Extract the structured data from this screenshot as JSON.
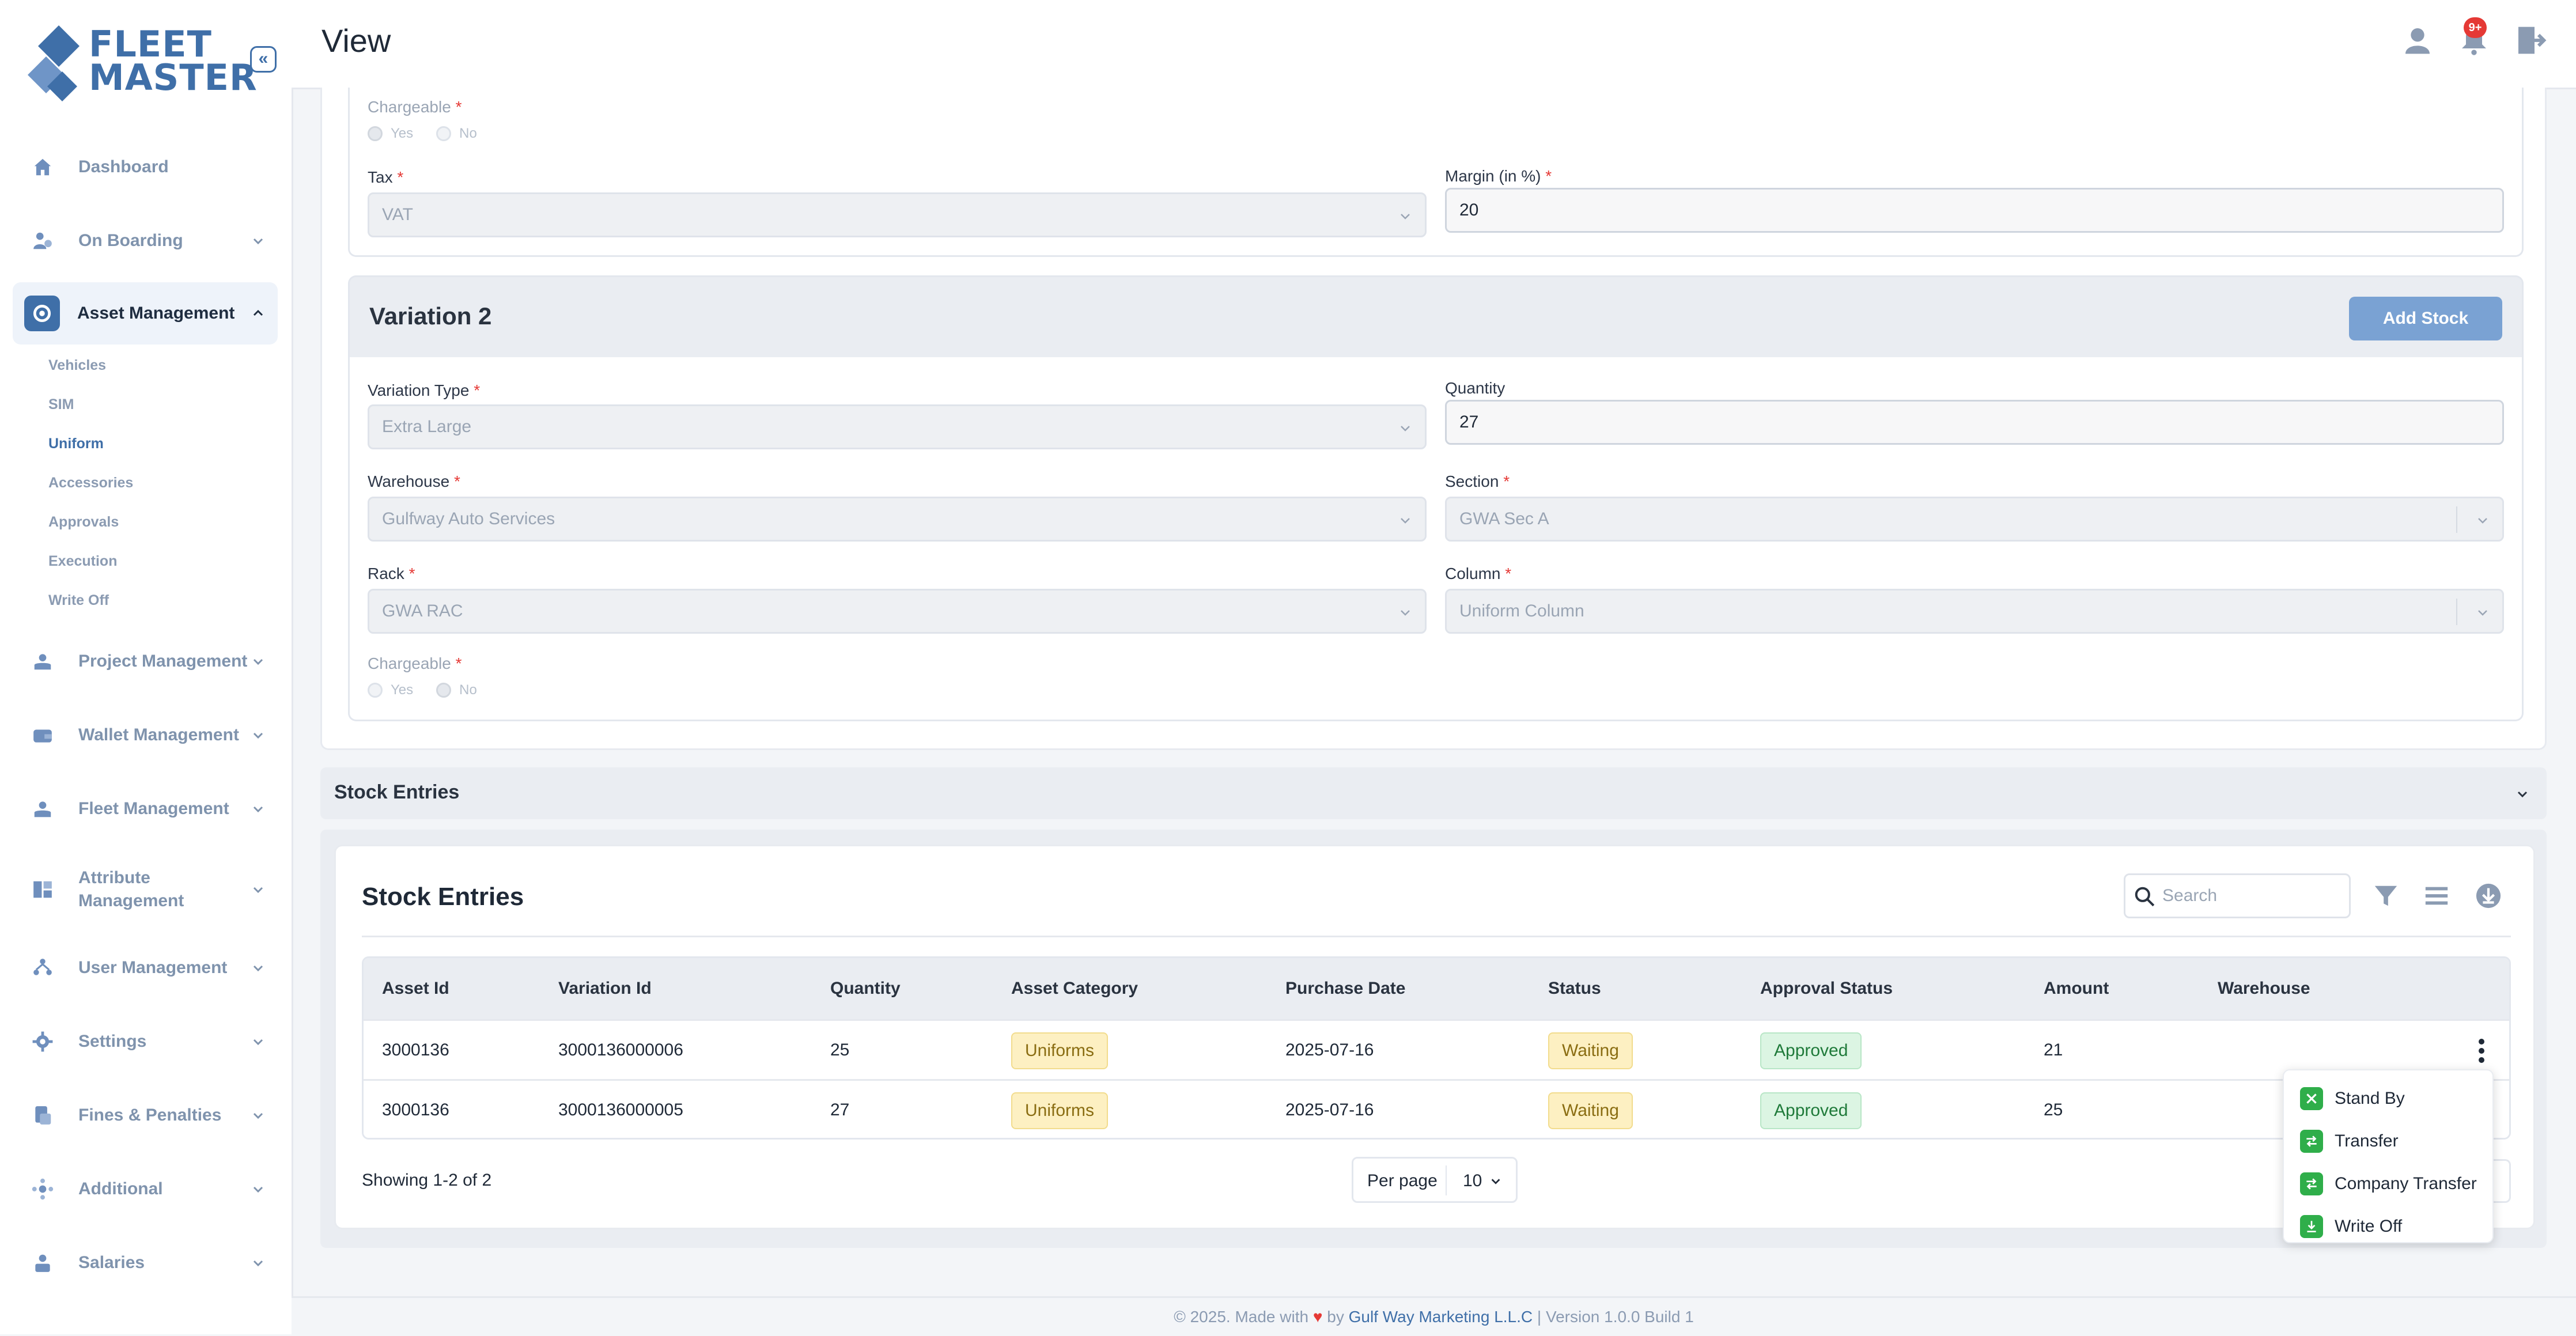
{
  "app": {
    "logo_line1": "FLEET",
    "logo_line2": "MASTER",
    "brand_color": "#3f6fa8",
    "collapse_icon": "double-chevron-left-icon"
  },
  "header": {
    "title": "View",
    "notification_badge": "9+",
    "icons": [
      "user-icon",
      "bell-icon",
      "logout-icon"
    ]
  },
  "sidebar": {
    "items": [
      {
        "label": "Dashboard",
        "icon": "home-icon"
      },
      {
        "label": "On Boarding",
        "icon": "onboarding-icon"
      },
      {
        "label": "Asset Management",
        "icon": "asset-icon"
      },
      {
        "label": "Project Management",
        "icon": "project-icon"
      },
      {
        "label": "Wallet Management",
        "icon": "wallet-icon"
      },
      {
        "label": "Fleet Management",
        "icon": "fleet-icon"
      },
      {
        "label": "Attribute Management",
        "icon": "attribute-icon"
      },
      {
        "label": "User Management",
        "icon": "users-icon"
      },
      {
        "label": "Settings",
        "icon": "gear-icon"
      },
      {
        "label": "Fines & Penalties",
        "icon": "fines-icon"
      },
      {
        "label": "Additional",
        "icon": "additional-icon"
      },
      {
        "label": "Salaries",
        "icon": "salaries-icon"
      }
    ],
    "asset_sub_items": [
      "Vehicles",
      "SIM",
      "Uniform",
      "Accessories",
      "Approvals",
      "Execution",
      "Write Off"
    ],
    "current_sub_item": "Uniform"
  },
  "variation1": {
    "chargeable_label": "Chargeable",
    "yes_label": "Yes",
    "no_label": "No",
    "tax_label": "Tax",
    "tax_value": "VAT",
    "margin_label": "Margin (in %)",
    "margin_value": "20"
  },
  "variation2": {
    "title": "Variation 2",
    "add_stock_label": "Add Stock",
    "variation_type_label": "Variation Type",
    "variation_type_value": "Extra Large",
    "quantity_label": "Quantity",
    "quantity_value": "27",
    "warehouse_label": "Warehouse",
    "warehouse_value": "Gulfway Auto Services",
    "section_label": "Section",
    "section_value": "GWA Sec A",
    "rack_label": "Rack",
    "rack_value": "GWA RAC",
    "column_label": "Column",
    "column_value": "Uniform Column",
    "chargeable_label": "Chargeable",
    "yes_label": "Yes",
    "no_label": "No"
  },
  "stock_entries_section": {
    "collapsible_title": "Stock Entries",
    "card_title": "Stock Entries",
    "search_placeholder": "Search",
    "columns": [
      "Asset Id",
      "Variation Id",
      "Quantity",
      "Asset Category",
      "Purchase Date",
      "Status",
      "Approval Status",
      "Amount",
      "Warehouse"
    ],
    "rows": [
      {
        "asset_id": "3000136",
        "variation_id": "3000136000006",
        "quantity": "25",
        "category": "Uniforms",
        "purchase_date": "2025-07-16",
        "status": "Waiting",
        "approval": "Approved",
        "amount": "21",
        "warehouse": ""
      },
      {
        "asset_id": "3000136",
        "variation_id": "3000136000005",
        "quantity": "27",
        "category": "Uniforms",
        "purchase_date": "2025-07-16",
        "status": "Waiting",
        "approval": "Approved",
        "amount": "25",
        "warehouse": ""
      }
    ],
    "showing_text": "Showing 1-2 of 2",
    "per_page_label": "Per page",
    "per_page_value": "10"
  },
  "row_menu": {
    "items": [
      "Stand By",
      "Transfer",
      "Company Transfer",
      "Write Off"
    ]
  },
  "footer": {
    "prefix": "© 2025. Made with",
    "by": "by",
    "company": "Gulf Way Marketing L.L.C",
    "version": "| Version 1.0.0 Build 1"
  }
}
